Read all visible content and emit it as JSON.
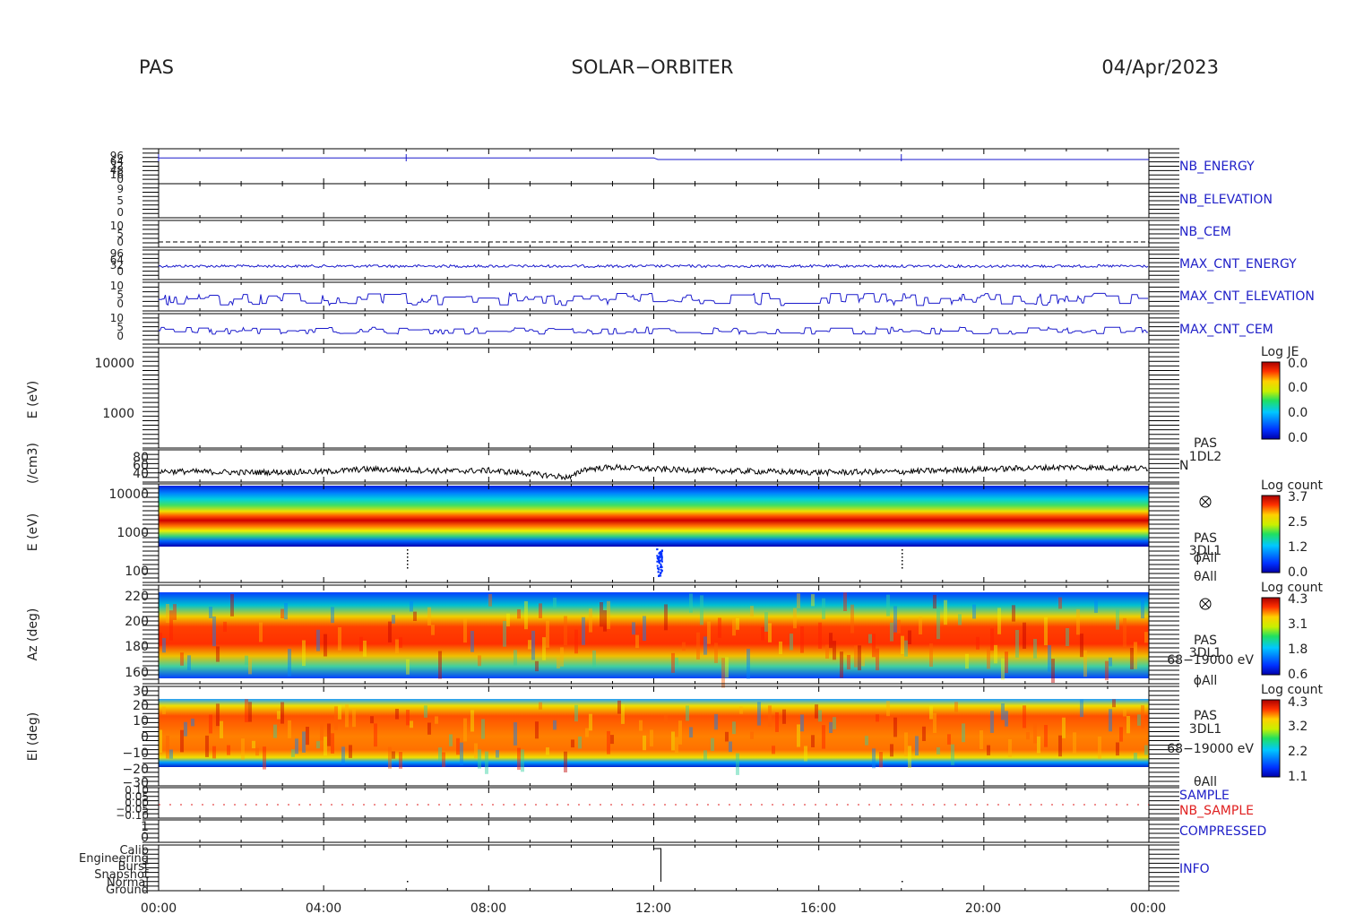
{
  "header": {
    "left": "PAS",
    "center": "SOLAR−ORBITER",
    "right": "04/Apr/2023"
  },
  "colors": {
    "trace": "#1a1acc",
    "label_blue": "#2020c8",
    "label_red": "#e02020",
    "axis": "#000000"
  },
  "x_axis": {
    "tick_labels": [
      "00:00",
      "04:00",
      "08:00",
      "12:00",
      "16:00",
      "20:00",
      "00:00"
    ],
    "range_hours": [
      0,
      24
    ]
  },
  "panels": {
    "nb_energy": {
      "label": "NB_ENERGY",
      "tick_labels": [
        "96",
        "64",
        "32",
        "48",
        "16",
        "0"
      ]
    },
    "nb_elevation": {
      "label": "NB_ELEVATION",
      "tick_labels": [
        "9",
        "5",
        "0"
      ]
    },
    "nb_cem": {
      "label": "NB_CEM",
      "tick_labels": [
        "10",
        "5",
        "0"
      ]
    },
    "max_cnt_energy": {
      "label": "MAX_CNT_ENERGY",
      "tick_labels": [
        "96",
        "64",
        "32",
        "0"
      ]
    },
    "max_cnt_elevation": {
      "label": "MAX_CNT_ELEVATION",
      "tick_labels": [
        "10",
        "5",
        "0"
      ]
    },
    "max_cnt_cem": {
      "label": "MAX_CNT_CEM",
      "tick_labels": [
        "10",
        "5",
        "0"
      ]
    },
    "e_ev_empty": {
      "ylabel": "E (eV)",
      "tick_labels": [
        "10000",
        "1000"
      ],
      "colorbar": {
        "title": "Log JE",
        "labels": [
          "0.0",
          "0.0",
          "0.0",
          "0.0"
        ]
      }
    },
    "density": {
      "ylabel": "(/cm3)",
      "tick_labels": [
        "80",
        "60",
        "40"
      ],
      "label_lines": [
        "PAS",
        "1DL2"
      ],
      "trace_label": "N"
    },
    "energy_spectrogram": {
      "ylabel": "E (eV)",
      "tick_labels": [
        "10000",
        "1000",
        "100"
      ],
      "label_lines": [
        "PAS",
        "3DL1"
      ],
      "phi_label": "ϕAll",
      "theta_label": "θAll",
      "colorbar": {
        "title": "Log count",
        "labels": [
          "3.7",
          "2.5",
          "1.2",
          "0.0"
        ]
      }
    },
    "azimuth_spectrogram": {
      "ylabel": "Az (deg)",
      "tick_labels": [
        "220",
        "200",
        "180",
        "160"
      ],
      "label_lines": [
        "PAS",
        "3DL1"
      ],
      "energy_range": "68−19000 eV",
      "phi_label": "ϕAll",
      "colorbar": {
        "title": "Log count",
        "labels": [
          "4.3",
          "3.1",
          "1.8",
          "0.6"
        ]
      }
    },
    "elevation_spectrogram": {
      "ylabel": "El (deg)",
      "tick_labels": [
        "30",
        "20",
        "10",
        "0",
        "−10",
        "−20",
        "−30"
      ],
      "label_lines": [
        "PAS",
        "3DL1"
      ],
      "energy_range": "68−19000 eV",
      "theta_label": "θAll",
      "colorbar": {
        "title": "Log count",
        "labels": [
          "4.3",
          "3.2",
          "2.2",
          "1.1"
        ]
      }
    },
    "sample": {
      "tick_labels": [
        "0.10",
        "0.05",
        "0.00",
        "−0.05",
        "−0.10"
      ],
      "label": "SAMPLE",
      "label2": "NB_SAMPLE"
    },
    "compressed": {
      "label": "COMPRESSED",
      "tick_labels": [
        "1",
        "0"
      ]
    },
    "info": {
      "label": "INFO",
      "tick_labels": [
        "Calib",
        "Engineering",
        "Burst",
        "Snapshot",
        "Normal",
        "Ground"
      ]
    }
  },
  "chart_data": [
    {
      "type": "line",
      "title": "NB_ENERGY",
      "x_range": [
        0,
        24
      ],
      "series": [
        {
          "name": "NB_ENERGY",
          "x": [
            0,
            12.0,
            12.1,
            24
          ],
          "y": [
            96,
            96,
            90,
            90
          ]
        }
      ]
    },
    {
      "type": "line",
      "title": "(/cm3)",
      "ylim": [
        35,
        85
      ],
      "series": [
        {
          "name": "N",
          "x": [
            0,
            2,
            4,
            5,
            6,
            7,
            8,
            9,
            10,
            10.3,
            11,
            12,
            14,
            16,
            18,
            20,
            22,
            24
          ],
          "y": [
            52,
            50,
            51,
            55,
            54,
            52,
            53,
            48,
            42,
            55,
            58,
            55,
            52,
            50,
            51,
            55,
            58,
            56
          ]
        }
      ]
    },
    {
      "type": "heatmap",
      "title": "E (eV)",
      "y_scale": "log",
      "ylim": [
        60,
        20000
      ],
      "peak_energy_ev": 1500,
      "colorbar_range": [
        0.0,
        3.7
      ]
    },
    {
      "type": "heatmap",
      "title": "Az (deg)",
      "ylim": [
        150,
        225
      ],
      "peak_deg": 185,
      "colorbar_range": [
        0.6,
        4.3
      ]
    },
    {
      "type": "heatmap",
      "title": "El (deg)",
      "ylim": [
        -30,
        30
      ],
      "peak_deg": 3,
      "colorbar_range": [
        1.1,
        4.3
      ]
    }
  ]
}
